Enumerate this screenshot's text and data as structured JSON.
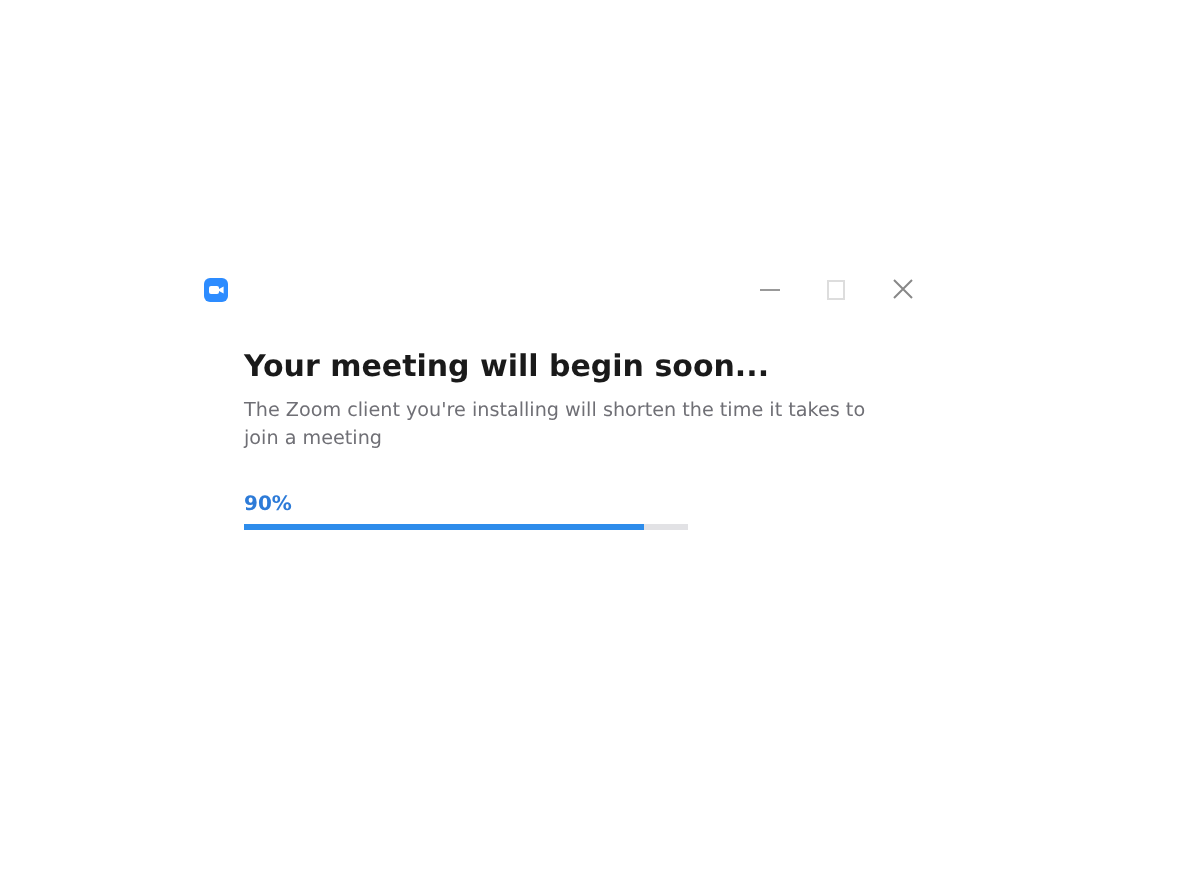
{
  "window": {
    "controls": [
      {
        "kind": "minimize"
      },
      {
        "kind": "maximize"
      },
      {
        "kind": "close"
      }
    ]
  },
  "title": "Your meeting will begin soon...",
  "description": "The Zoom client you're installing will shorten the time it takes to join a meeting",
  "progress": {
    "reading": "90%",
    "level": 0.9
  }
}
